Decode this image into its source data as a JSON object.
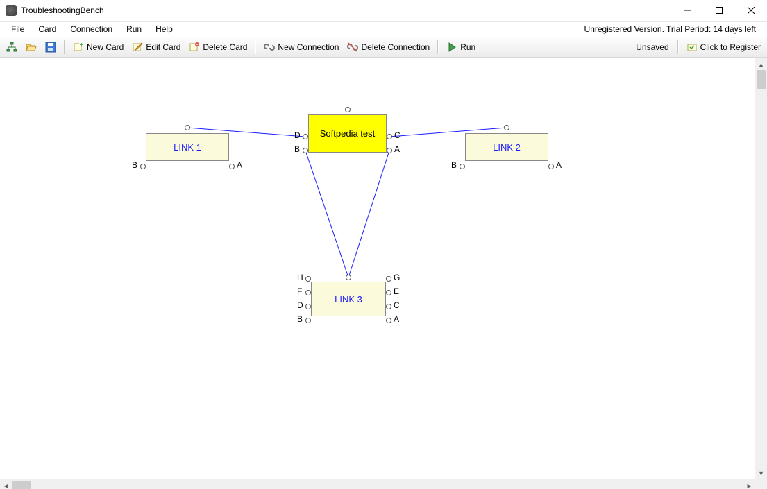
{
  "window": {
    "title": "TroubleshootingBench"
  },
  "menu": {
    "file": "File",
    "card": "Card",
    "connection": "Connection",
    "run": "Run",
    "help": "Help",
    "trial": "Unregistered Version. Trial Period: 14 days left"
  },
  "toolbar": {
    "new_card": "New Card",
    "edit_card": "Edit Card",
    "delete_card": "Delete Card",
    "new_connection": "New Connection",
    "delete_connection": "Delete Connection",
    "run": "Run",
    "unsaved": "Unsaved",
    "register": "Click to Register"
  },
  "canvas": {
    "cards": {
      "softpedia": {
        "label": "Softpedia test"
      },
      "link1": {
        "label": "LINK 1",
        "ports": {
          "left": "B",
          "right": "A"
        }
      },
      "link2": {
        "label": "LINK 2",
        "ports": {
          "left": "B",
          "right": "A"
        }
      },
      "link3": {
        "label": "LINK 3",
        "ports": {
          "l1": "H",
          "r1": "G",
          "l2": "F",
          "r2": "E",
          "l3": "D",
          "r3": "C",
          "l4": "B",
          "r4": "A"
        }
      },
      "center_ports": {
        "l1": "D",
        "r1": "C",
        "l2": "B",
        "r2": "A"
      }
    }
  }
}
